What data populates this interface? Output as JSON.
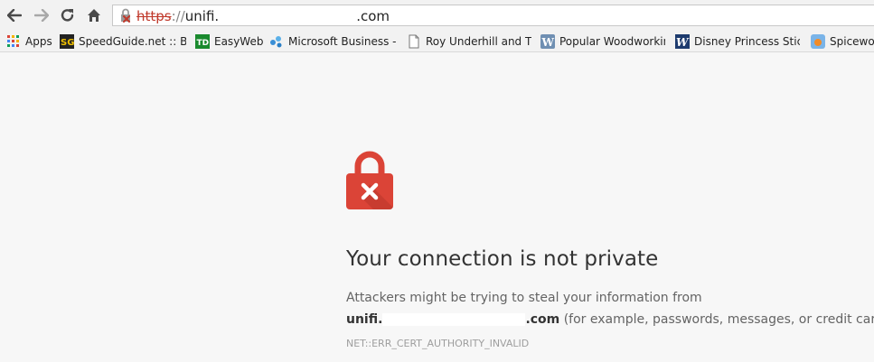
{
  "browser": {
    "address_bar": {
      "scheme": "https",
      "separator": "://",
      "host_visible": "unifi.",
      "tld": ".com"
    },
    "bookmarks": [
      {
        "label": "Apps",
        "icon": "apps-grid-icon"
      },
      {
        "label": "SpeedGuide.net :: Bits",
        "icon": "speedguide-icon"
      },
      {
        "label": "EasyWeb",
        "icon": "td-bank-icon"
      },
      {
        "label": "Microsoft Business - S",
        "icon": "microsoft-butterfly-icon"
      },
      {
        "label": "Roy Underhill and The",
        "icon": "page-icon"
      },
      {
        "label": "Popular Woodworking",
        "icon": "wordpress-icon"
      },
      {
        "label": "Disney Princess Sticke",
        "icon": "w-logo-icon"
      },
      {
        "label": "Spicewor",
        "icon": "spiceworks-icon"
      }
    ]
  },
  "interstitial": {
    "heading": "Your connection is not private",
    "explanation_line1": "Attackers might be trying to steal your information from",
    "host_bold_prefix": "unifi.",
    "host_bold_suffix": ".com",
    "explanation_line2_tail": " (for example, passwords, messages, or credit cards).",
    "error_code": "NET::ERR_CERT_AUTHORITY_INVALID"
  },
  "colors": {
    "lock_red": "#db4437",
    "lock_shadow": "#b8362c",
    "scheme_red": "#c0392b",
    "page_bg": "#f7f7f7"
  }
}
